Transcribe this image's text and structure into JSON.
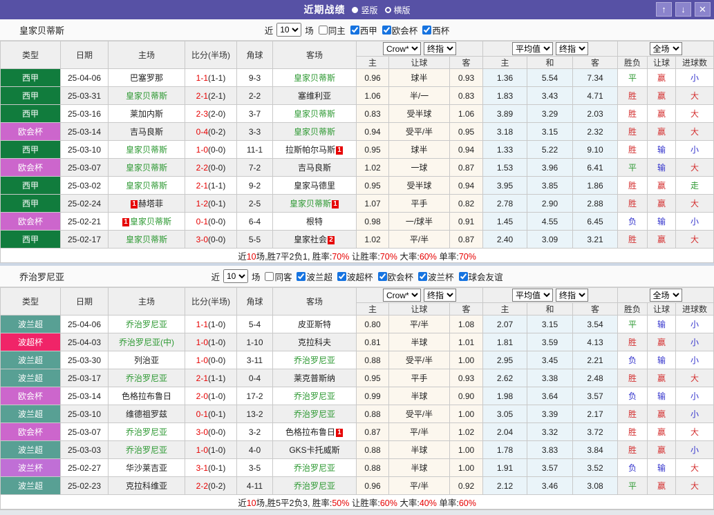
{
  "titlebar": {
    "title": "近期战绩",
    "view_options": [
      {
        "label": "竖版",
        "selected": true
      },
      {
        "label": "横版",
        "selected": false
      }
    ],
    "buttons": {
      "up": "↑",
      "down": "↓",
      "close": "✕"
    },
    "bar_color": "#5751a5"
  },
  "table_header": {
    "cols": [
      "类型",
      "日期",
      "主场",
      "比分(半场)",
      "角球",
      "客场"
    ],
    "odds_group": {
      "select1": "Crow*",
      "select2": "终指",
      "subcols": [
        "主",
        "让球",
        "客"
      ]
    },
    "avg_group": {
      "select1": "平均值",
      "select2": "终指",
      "subcols": [
        "主",
        "和",
        "客"
      ]
    },
    "result_group": {
      "select1": "全场",
      "subcols": [
        "胜负",
        "让球",
        "进球数"
      ]
    }
  },
  "league_colors": {
    "西甲": "#117c3d",
    "欧会杯": "#cc66cc",
    "波兰超": "#58a094",
    "波超杯": "#f02468",
    "波兰杯": "#c06fd6"
  },
  "sections": [
    {
      "team": "皇家贝蒂斯",
      "filter": {
        "near_label": "近",
        "count": "10",
        "games_label": "场",
        "same": {
          "label": "同主",
          "checked": false
        },
        "leagues": [
          {
            "label": "西甲",
            "checked": true
          },
          {
            "label": "欧会杯",
            "checked": true
          },
          {
            "label": "西杯",
            "checked": true
          }
        ]
      },
      "rows": [
        {
          "league": "西甲",
          "date": "25-04-06",
          "home": {
            "name": "巴塞罗那"
          },
          "score": "1-1",
          "half": "(1-1)",
          "corner": "9-3",
          "away": {
            "name": "皇家贝蒂斯",
            "focus": true
          },
          "odds": [
            "0.96",
            "球半",
            "0.93"
          ],
          "avg": [
            "1.36",
            "5.54",
            "7.34"
          ],
          "results": [
            [
              "平",
              "g"
            ],
            [
              "赢",
              "r"
            ],
            [
              "小",
              "b"
            ]
          ]
        },
        {
          "league": "西甲",
          "date": "25-03-31",
          "home": {
            "name": "皇家贝蒂斯",
            "focus": true
          },
          "score": "2-1",
          "half": "(2-1)",
          "corner": "2-2",
          "away": {
            "name": "塞维利亚"
          },
          "odds": [
            "1.06",
            "半/一",
            "0.83"
          ],
          "avg": [
            "1.83",
            "3.43",
            "4.71"
          ],
          "results": [
            [
              "胜",
              "r"
            ],
            [
              "赢",
              "r"
            ],
            [
              "大",
              "r"
            ]
          ]
        },
        {
          "league": "西甲",
          "date": "25-03-16",
          "home": {
            "name": "莱加内斯"
          },
          "score": "2-3",
          "half": "(2-0)",
          "corner": "3-7",
          "away": {
            "name": "皇家贝蒂斯",
            "focus": true
          },
          "odds": [
            "0.83",
            "受半球",
            "1.06"
          ],
          "avg": [
            "3.89",
            "3.29",
            "2.03"
          ],
          "results": [
            [
              "胜",
              "r"
            ],
            [
              "赢",
              "r"
            ],
            [
              "大",
              "r"
            ]
          ]
        },
        {
          "league": "欧会杯",
          "date": "25-03-14",
          "home": {
            "name": "吉马良斯"
          },
          "score": "0-4",
          "half": "(0-2)",
          "corner": "3-3",
          "away": {
            "name": "皇家贝蒂斯",
            "focus": true
          },
          "odds": [
            "0.94",
            "受平/半",
            "0.95"
          ],
          "avg": [
            "3.18",
            "3.15",
            "2.32"
          ],
          "results": [
            [
              "胜",
              "r"
            ],
            [
              "赢",
              "r"
            ],
            [
              "大",
              "r"
            ]
          ]
        },
        {
          "league": "西甲",
          "date": "25-03-10",
          "home": {
            "name": "皇家贝蒂斯",
            "focus": true
          },
          "score": "1-0",
          "half": "(0-0)",
          "corner": "11-1",
          "away": {
            "name": "拉斯帕尔马斯",
            "badge": {
              "text": "1",
              "pos": "after"
            }
          },
          "odds": [
            "0.95",
            "球半",
            "0.94"
          ],
          "avg": [
            "1.33",
            "5.22",
            "9.10"
          ],
          "results": [
            [
              "胜",
              "r"
            ],
            [
              "输",
              "b"
            ],
            [
              "小",
              "b"
            ]
          ]
        },
        {
          "league": "欧会杯",
          "date": "25-03-07",
          "home": {
            "name": "皇家贝蒂斯",
            "focus": true
          },
          "score": "2-2",
          "half": "(0-0)",
          "corner": "7-2",
          "away": {
            "name": "吉马良斯"
          },
          "odds": [
            "1.02",
            "一球",
            "0.87"
          ],
          "avg": [
            "1.53",
            "3.96",
            "6.41"
          ],
          "results": [
            [
              "平",
              "g"
            ],
            [
              "输",
              "b"
            ],
            [
              "大",
              "r"
            ]
          ]
        },
        {
          "league": "西甲",
          "date": "25-03-02",
          "home": {
            "name": "皇家贝蒂斯",
            "focus": true
          },
          "score": "2-1",
          "half": "(1-1)",
          "corner": "9-2",
          "away": {
            "name": "皇家马德里"
          },
          "odds": [
            "0.95",
            "受半球",
            "0.94"
          ],
          "avg": [
            "3.95",
            "3.85",
            "1.86"
          ],
          "results": [
            [
              "胜",
              "r"
            ],
            [
              "赢",
              "r"
            ],
            [
              "走",
              "g"
            ]
          ]
        },
        {
          "league": "西甲",
          "date": "25-02-24",
          "home": {
            "name": "赫塔菲",
            "badge": {
              "text": "1",
              "pos": "before"
            }
          },
          "score": "1-2",
          "half": "(0-1)",
          "corner": "2-5",
          "away": {
            "name": "皇家贝蒂斯",
            "focus": true,
            "badge": {
              "text": "1",
              "pos": "after"
            }
          },
          "odds": [
            "1.07",
            "平手",
            "0.82"
          ],
          "avg": [
            "2.78",
            "2.90",
            "2.88"
          ],
          "results": [
            [
              "胜",
              "r"
            ],
            [
              "赢",
              "r"
            ],
            [
              "大",
              "r"
            ]
          ]
        },
        {
          "league": "欧会杯",
          "date": "25-02-21",
          "home": {
            "name": "皇家贝蒂斯",
            "focus": true,
            "badge": {
              "text": "1",
              "pos": "before"
            }
          },
          "score": "0-1",
          "half": "(0-0)",
          "corner": "6-4",
          "away": {
            "name": "根特"
          },
          "odds": [
            "0.98",
            "一/球半",
            "0.91"
          ],
          "avg": [
            "1.45",
            "4.55",
            "6.45"
          ],
          "results": [
            [
              "负",
              "b"
            ],
            [
              "输",
              "b"
            ],
            [
              "小",
              "b"
            ]
          ]
        },
        {
          "league": "西甲",
          "date": "25-02-17",
          "home": {
            "name": "皇家贝蒂斯",
            "focus": true
          },
          "score": "3-0",
          "half": "(0-0)",
          "corner": "5-5",
          "away": {
            "name": "皇家社会",
            "badge": {
              "text": "2",
              "pos": "after"
            }
          },
          "odds": [
            "1.02",
            "平/半",
            "0.87"
          ],
          "avg": [
            "2.40",
            "3.09",
            "3.21"
          ],
          "results": [
            [
              "胜",
              "r"
            ],
            [
              "赢",
              "r"
            ],
            [
              "大",
              "r"
            ]
          ]
        }
      ],
      "summary": [
        {
          "text": "近",
          "red": false
        },
        {
          "text": "10",
          "red": true
        },
        {
          "text": "场,胜7平2负1, 胜率:",
          "red": false
        },
        {
          "text": "70%",
          "red": true
        },
        {
          "text": " 让胜率:",
          "red": false
        },
        {
          "text": "70%",
          "red": true
        },
        {
          "text": " 大率:",
          "red": false
        },
        {
          "text": "60%",
          "red": true
        },
        {
          "text": " 单率:",
          "red": false
        },
        {
          "text": "70%",
          "red": true
        }
      ]
    },
    {
      "team": "乔治罗尼亚",
      "filter": {
        "near_label": "近",
        "count": "10",
        "games_label": "场",
        "same": {
          "label": "同客",
          "checked": false
        },
        "leagues": [
          {
            "label": "波兰超",
            "checked": true
          },
          {
            "label": "波超杯",
            "checked": true
          },
          {
            "label": "欧会杯",
            "checked": true
          },
          {
            "label": "波兰杯",
            "checked": true
          },
          {
            "label": "球会友谊",
            "checked": true
          }
        ]
      },
      "rows": [
        {
          "league": "波兰超",
          "date": "25-04-06",
          "home": {
            "name": "乔治罗尼亚",
            "focus": true
          },
          "score": "1-1",
          "half": "(1-0)",
          "corner": "5-4",
          "away": {
            "name": "皮亚斯特"
          },
          "odds": [
            "0.80",
            "平/半",
            "1.08"
          ],
          "avg": [
            "2.07",
            "3.15",
            "3.54"
          ],
          "results": [
            [
              "平",
              "g"
            ],
            [
              "输",
              "b"
            ],
            [
              "小",
              "b"
            ]
          ]
        },
        {
          "league": "波超杯",
          "date": "25-04-03",
          "home": {
            "name": "乔治罗尼亚(中)",
            "focus": true
          },
          "score": "1-0",
          "half": "(1-0)",
          "corner": "1-10",
          "away": {
            "name": "克拉科夫"
          },
          "odds": [
            "0.81",
            "半球",
            "1.01"
          ],
          "avg": [
            "1.81",
            "3.59",
            "4.13"
          ],
          "results": [
            [
              "胜",
              "r"
            ],
            [
              "赢",
              "r"
            ],
            [
              "小",
              "b"
            ]
          ]
        },
        {
          "league": "波兰超",
          "date": "25-03-30",
          "home": {
            "name": "列治亚"
          },
          "score": "1-0",
          "half": "(0-0)",
          "corner": "3-11",
          "away": {
            "name": "乔治罗尼亚",
            "focus": true
          },
          "odds": [
            "0.88",
            "受平/半",
            "1.00"
          ],
          "avg": [
            "2.95",
            "3.45",
            "2.21"
          ],
          "results": [
            [
              "负",
              "b"
            ],
            [
              "输",
              "b"
            ],
            [
              "小",
              "b"
            ]
          ]
        },
        {
          "league": "波兰超",
          "date": "25-03-17",
          "home": {
            "name": "乔治罗尼亚",
            "focus": true
          },
          "score": "2-1",
          "half": "(1-1)",
          "corner": "0-4",
          "away": {
            "name": "莱克普斯纳"
          },
          "odds": [
            "0.95",
            "平手",
            "0.93"
          ],
          "avg": [
            "2.62",
            "3.38",
            "2.48"
          ],
          "results": [
            [
              "胜",
              "r"
            ],
            [
              "赢",
              "r"
            ],
            [
              "大",
              "r"
            ]
          ]
        },
        {
          "league": "欧会杯",
          "date": "25-03-14",
          "home": {
            "name": "色格拉布鲁日"
          },
          "score": "2-0",
          "half": "(1-0)",
          "corner": "17-2",
          "away": {
            "name": "乔治罗尼亚",
            "focus": true
          },
          "odds": [
            "0.99",
            "半球",
            "0.90"
          ],
          "avg": [
            "1.98",
            "3.64",
            "3.57"
          ],
          "results": [
            [
              "负",
              "b"
            ],
            [
              "输",
              "b"
            ],
            [
              "小",
              "b"
            ]
          ]
        },
        {
          "league": "波兰超",
          "date": "25-03-10",
          "home": {
            "name": "维德祖罗兹"
          },
          "score": "0-1",
          "half": "(0-1)",
          "corner": "13-2",
          "away": {
            "name": "乔治罗尼亚",
            "focus": true
          },
          "odds": [
            "0.88",
            "受平/半",
            "1.00"
          ],
          "avg": [
            "3.05",
            "3.39",
            "2.17"
          ],
          "results": [
            [
              "胜",
              "r"
            ],
            [
              "赢",
              "r"
            ],
            [
              "小",
              "b"
            ]
          ]
        },
        {
          "league": "欧会杯",
          "date": "25-03-07",
          "home": {
            "name": "乔治罗尼亚",
            "focus": true
          },
          "score": "3-0",
          "half": "(0-0)",
          "corner": "3-2",
          "away": {
            "name": "色格拉布鲁日",
            "badge": {
              "text": "1",
              "pos": "after"
            }
          },
          "odds": [
            "0.87",
            "平/半",
            "1.02"
          ],
          "avg": [
            "2.04",
            "3.32",
            "3.72"
          ],
          "results": [
            [
              "胜",
              "r"
            ],
            [
              "赢",
              "r"
            ],
            [
              "大",
              "r"
            ]
          ]
        },
        {
          "league": "波兰超",
          "date": "25-03-03",
          "home": {
            "name": "乔治罗尼亚",
            "focus": true
          },
          "score": "1-0",
          "half": "(1-0)",
          "corner": "4-0",
          "away": {
            "name": "GKS卡托威斯"
          },
          "odds": [
            "0.88",
            "半球",
            "1.00"
          ],
          "avg": [
            "1.78",
            "3.83",
            "3.84"
          ],
          "results": [
            [
              "胜",
              "r"
            ],
            [
              "赢",
              "r"
            ],
            [
              "小",
              "b"
            ]
          ]
        },
        {
          "league": "波兰杯",
          "date": "25-02-27",
          "home": {
            "name": "华沙莱吉亚"
          },
          "score": "3-1",
          "half": "(0-1)",
          "corner": "3-5",
          "away": {
            "name": "乔治罗尼亚",
            "focus": true
          },
          "odds": [
            "0.88",
            "半球",
            "1.00"
          ],
          "avg": [
            "1.91",
            "3.57",
            "3.52"
          ],
          "results": [
            [
              "负",
              "b"
            ],
            [
              "输",
              "b"
            ],
            [
              "大",
              "r"
            ]
          ]
        },
        {
          "league": "波兰超",
          "date": "25-02-23",
          "home": {
            "name": "克拉科维亚"
          },
          "score": "2-2",
          "half": "(0-2)",
          "corner": "4-11",
          "away": {
            "name": "乔治罗尼亚",
            "focus": true
          },
          "odds": [
            "0.96",
            "平/半",
            "0.92"
          ],
          "avg": [
            "2.12",
            "3.46",
            "3.08"
          ],
          "results": [
            [
              "平",
              "g"
            ],
            [
              "赢",
              "r"
            ],
            [
              "大",
              "r"
            ]
          ]
        }
      ],
      "summary": [
        {
          "text": "近",
          "red": false
        },
        {
          "text": "10",
          "red": true
        },
        {
          "text": "场,胜5平2负3, 胜率:",
          "red": false
        },
        {
          "text": "50%",
          "red": true
        },
        {
          "text": " 让胜率:",
          "red": false
        },
        {
          "text": "60%",
          "red": true
        },
        {
          "text": " 大率:",
          "red": false
        },
        {
          "text": "40%",
          "red": true
        },
        {
          "text": " 单率:",
          "red": false
        },
        {
          "text": "60%",
          "red": true
        }
      ]
    }
  ]
}
